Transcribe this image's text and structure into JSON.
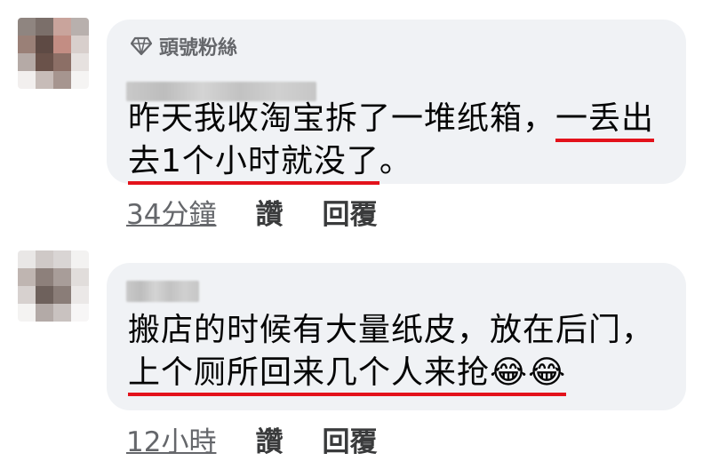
{
  "comments": [
    {
      "badge": "頭號粉絲",
      "text_plain": "昨天我收淘宝拆了一堆纸箱，",
      "text_underlined_1": "一丢出",
      "text_underlined_2": "去1个小时就没了",
      "text_end": "。",
      "time": "34分鐘",
      "like": "讚",
      "reply": "回覆"
    },
    {
      "text_line1": "搬店的时候有大量纸皮，放在后门，",
      "text_underlined": "上个厕所回来几个人来抢😂😂",
      "time": "12小時",
      "like": "讚",
      "reply": "回覆"
    }
  ],
  "colors": {
    "bubble": "#f0f2f5",
    "underline": "#e3121b",
    "meta": "#65676b"
  }
}
